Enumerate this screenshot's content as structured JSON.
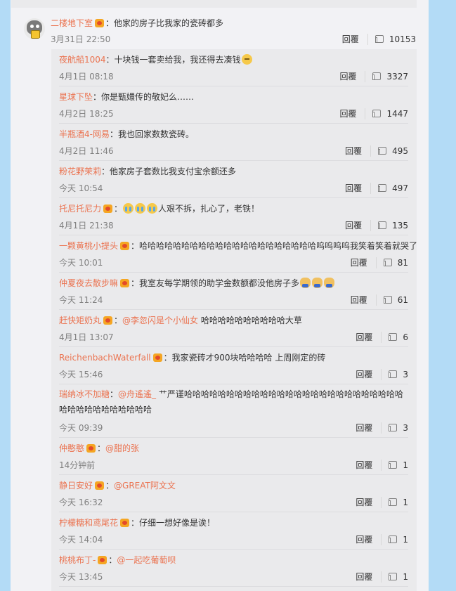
{
  "main_comment": {
    "username": "二楼地下室",
    "text": "：他家的房子比我家的瓷砖都多",
    "time": "3月31日 22:50",
    "reply_label": "回覆",
    "likes": "10153"
  },
  "replies": [
    {
      "username": "夜航船1004",
      "has_badge": false,
      "text": "：十块钱一套卖给我，我还得去凑钱",
      "emojis": [
        "sweat-emoji"
      ],
      "time": "4月1日 08:18",
      "reply_label": "回覆",
      "likes": "3327"
    },
    {
      "username": "星球下坠",
      "has_badge": false,
      "text": "：你是甄嬛传的敬妃么……",
      "time": "4月2日 18:25",
      "reply_label": "回覆",
      "likes": "1447"
    },
    {
      "username": "半瓶酒4-网易",
      "has_badge": false,
      "text": "：我也回家数数瓷砖。",
      "time": "4月2日 11:46",
      "reply_label": "回覆",
      "likes": "495"
    },
    {
      "username": "粉花野茉莉",
      "has_badge": false,
      "text": "：他家房子套数比我支付宝余额还多",
      "time": "今天 10:54",
      "reply_label": "回覆",
      "likes": "497"
    },
    {
      "username": "托尼托尼力",
      "has_badge": true,
      "text_after_emoji": "人艰不拆，扎心了，老铁！",
      "emojis": [
        "cry-emoji",
        "cry-emoji",
        "cry-emoji"
      ],
      "time": "4月1日 21:38",
      "reply_label": "回覆",
      "likes": "135"
    },
    {
      "username": "一颗黄桃小提头",
      "has_badge": true,
      "text": "：哈哈哈哈哈哈哈哈哈哈哈哈哈哈哈哈哈哈哈哈哈呜呜呜呜我笑着笑着就哭了",
      "time": "今天 10:01",
      "reply_label": "回覆",
      "likes": "81"
    },
    {
      "username": "仲夏夜去散步嘛",
      "has_badge": true,
      "text": "：我室友每学期领的助学金数额都没他房子多",
      "emojis": [
        "doge-emoji",
        "doge-emoji",
        "doge-emoji"
      ],
      "time": "今天 11:24",
      "reply_label": "回覆",
      "likes": "61"
    },
    {
      "username": "赶快矩奶丸",
      "has_badge": true,
      "mention": "@李忽闪是个小仙女",
      "text": " 哈哈哈哈哈哈哈哈哈哈大草",
      "time": "4月1日 13:07",
      "reply_label": "回覆",
      "likes": "6"
    },
    {
      "username": "ReichenbachWaterfall",
      "has_badge": true,
      "text": "：我家瓷砖才900块哈哈哈哈 上周刚定的砖",
      "time": "今天 15:46",
      "reply_label": "回覆",
      "likes": "3"
    },
    {
      "username": "瑞纳冰不加糖",
      "has_badge": false,
      "mention": "@舟遙遙_",
      "text": " 艹严谨哈哈哈哈哈哈哈哈哈哈哈哈哈哈哈哈哈哈哈哈哈哈哈哈哈哈哈哈哈哈哈哈哈哈哈哈哈",
      "time": "今天 09:39",
      "reply_label": "回覆",
      "likes": "3"
    },
    {
      "username": "仲憨憨",
      "has_badge": true,
      "mention": "@甜的张",
      "text": "",
      "time": "14分钟前",
      "reply_label": "回覆",
      "likes": "1"
    },
    {
      "username": "静日安好",
      "has_badge": true,
      "mention": "@GREAT阿文文",
      "text": "",
      "time": "今天 16:32",
      "reply_label": "回覆",
      "likes": "1"
    },
    {
      "username": "柠檬糖和鸢尾花",
      "has_badge": true,
      "text": "：仔细一想好像是诶！",
      "time": "今天 14:04",
      "reply_label": "回覆",
      "likes": "1"
    },
    {
      "username": "桃桃布丁-",
      "has_badge": true,
      "mention": "@一起吃葡萄呗",
      "text": "",
      "time": "今天 13:45",
      "reply_label": "回覆",
      "likes": "1"
    }
  ]
}
